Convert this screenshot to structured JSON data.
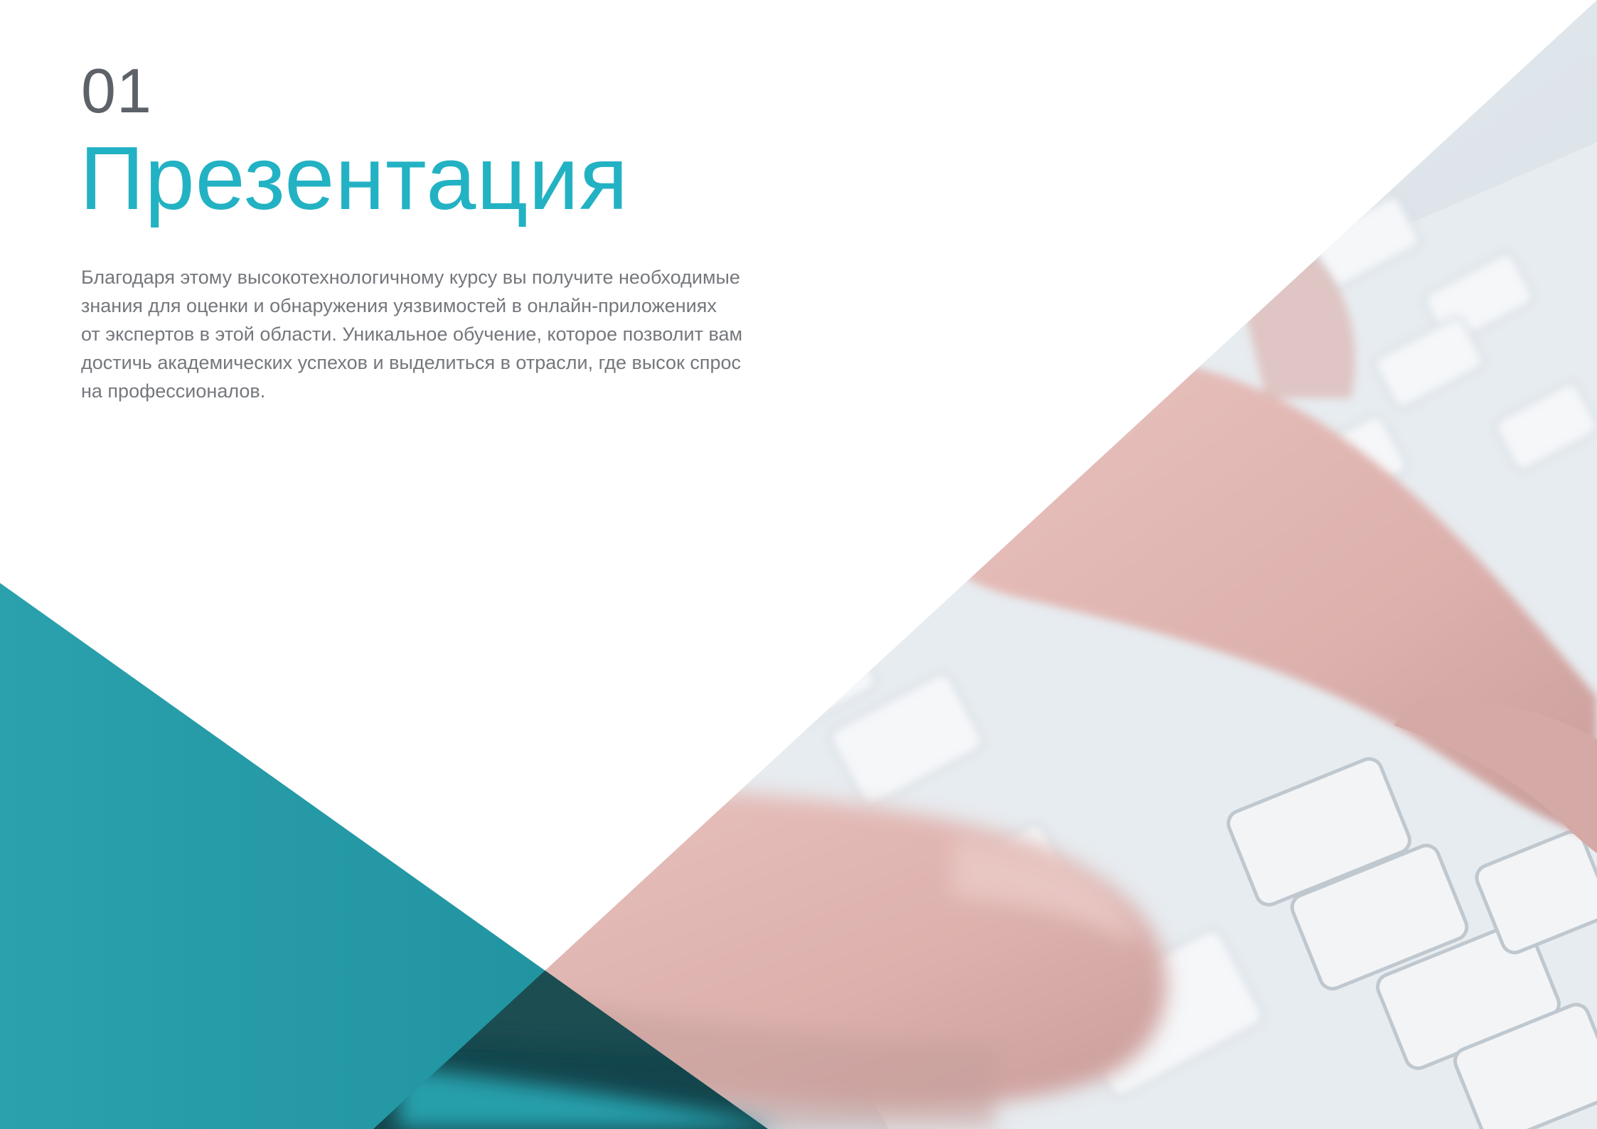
{
  "section": {
    "number": "01",
    "title": "Презентация"
  },
  "intro": {
    "lines": [
      "Благодаря этому высокотехнологичному курсу вы получите необходимые",
      "знания для оценки и обнаружения уязвимостей в онлайн-приложениях",
      "от экспертов в этой области. Уникальное обучение, которое позволит вам",
      "достичь академических успехов и выделиться в отрасли, где высок спрос",
      "на профессионалов."
    ]
  },
  "colors": {
    "accent": "#22b2c3",
    "number_gray": "#5d6168",
    "text_gray": "#74777c",
    "teal_triangle": "#2aa1ad",
    "teal_overlap": "#174b50"
  },
  "image": {
    "subject": "hand-typing-on-keyboard"
  }
}
